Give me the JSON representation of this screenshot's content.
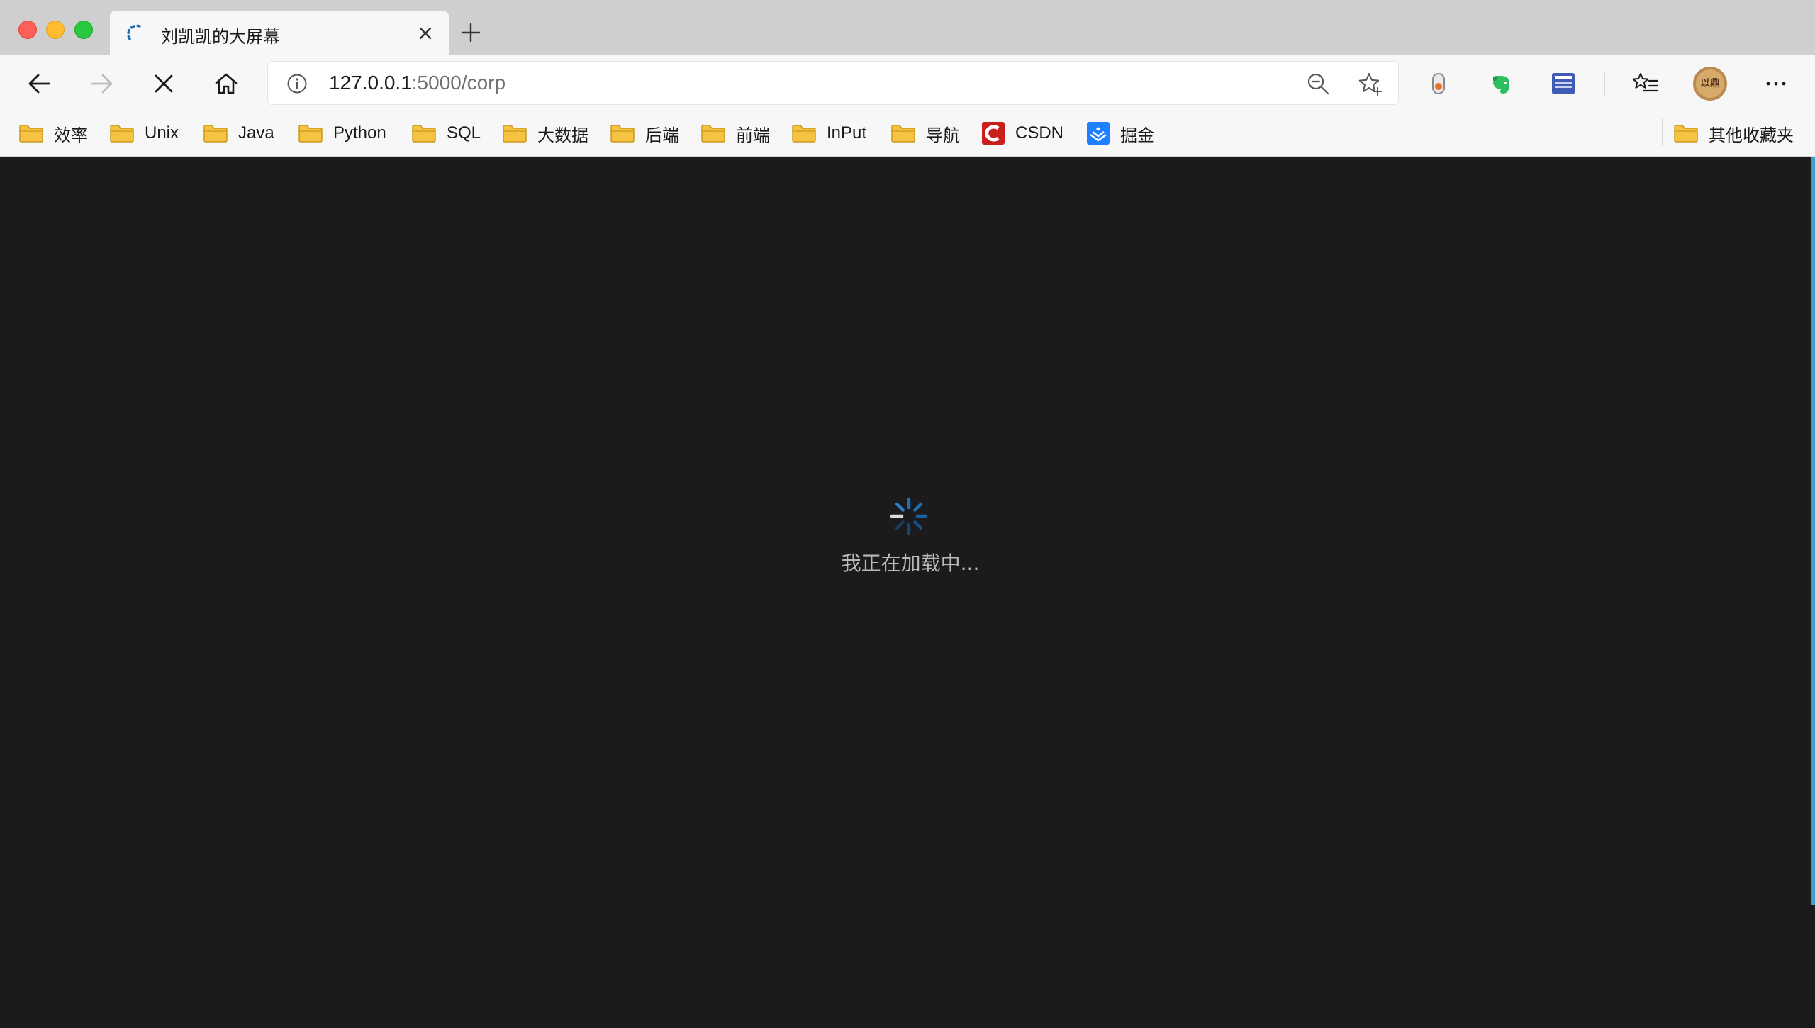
{
  "window": {
    "active_tab": {
      "favicon": "loading-arc-icon",
      "title": "刘凯凯的大屏幕"
    }
  },
  "toolbar": {
    "address": {
      "host": "127.0.0.1",
      "rest": ":5000/corp"
    },
    "icons": [
      "back-arrow-icon",
      "forward-arrow-icon",
      "stop-loading-icon",
      "home-icon",
      "info-icon",
      "zoom-out-icon",
      "add-favorite-icon",
      "extension-icon",
      "evernote-icon",
      "reader-icon",
      "favorites-list-icon",
      "profile-avatar",
      "more-icon"
    ],
    "avatar_text": "以鼎"
  },
  "bookmarks": {
    "items": [
      {
        "label": "效率",
        "icon": "folder-icon"
      },
      {
        "label": "Unix",
        "icon": "folder-icon"
      },
      {
        "label": "Java",
        "icon": "folder-icon"
      },
      {
        "label": "Python",
        "icon": "folder-icon"
      },
      {
        "label": "SQL",
        "icon": "folder-icon"
      },
      {
        "label": "大数据",
        "icon": "folder-icon"
      },
      {
        "label": "后端",
        "icon": "folder-icon"
      },
      {
        "label": "前端",
        "icon": "folder-icon"
      },
      {
        "label": "InPut",
        "icon": "folder-icon"
      },
      {
        "label": "导航",
        "icon": "folder-icon"
      },
      {
        "label": "CSDN",
        "icon": "csdn-icon"
      },
      {
        "label": "掘金",
        "icon": "juejin-icon"
      }
    ],
    "other": {
      "label": "其他收藏夹",
      "icon": "folder-icon"
    }
  },
  "page": {
    "loading_text": "我正在加载中...",
    "spinner": "loading-spinner-icon"
  },
  "colors": {
    "page_background": "#1b1b1d",
    "spinner": "#1f6fb2",
    "folder": "#f5c242",
    "csdn": "#c9201c",
    "juejin": "#1e80ff",
    "evernote": "#2dbe60"
  }
}
